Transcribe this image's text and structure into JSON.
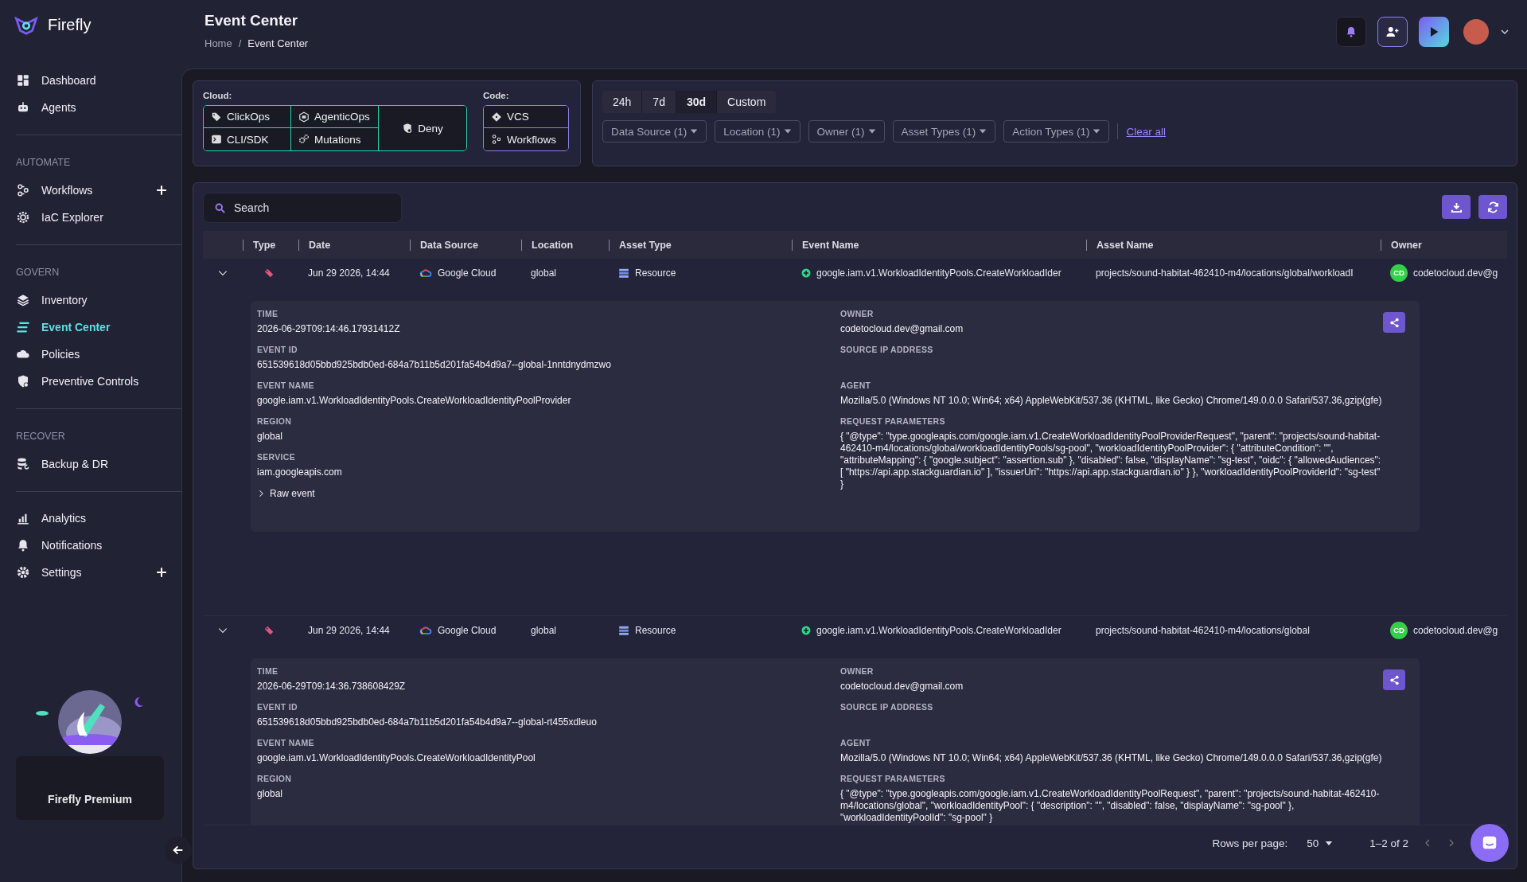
{
  "brand": {
    "name": "Firefly"
  },
  "sidebar": {
    "sections": [
      {
        "items": [
          {
            "label": "Dashboard",
            "selected": false,
            "addable": false
          },
          {
            "label": "Agents",
            "selected": false,
            "addable": false
          }
        ]
      },
      {
        "heading": "AUTOMATE",
        "items": [
          {
            "label": "Workflows",
            "selected": false,
            "addable": true
          },
          {
            "label": "IaC Explorer",
            "selected": false,
            "addable": false
          }
        ]
      },
      {
        "heading": "GOVERN",
        "items": [
          {
            "label": "Inventory",
            "selected": false,
            "addable": false
          },
          {
            "label": "Event Center",
            "selected": true,
            "addable": false
          },
          {
            "label": "Policies",
            "selected": false,
            "addable": false
          },
          {
            "label": "Preventive Controls",
            "selected": false,
            "addable": false
          }
        ]
      },
      {
        "heading": "RECOVER",
        "items": [
          {
            "label": "Backup & DR",
            "selected": false,
            "addable": false
          }
        ]
      },
      {
        "items": [
          {
            "label": "Analytics",
            "selected": false,
            "addable": false
          },
          {
            "label": "Notifications",
            "selected": false,
            "addable": false
          },
          {
            "label": "Settings",
            "selected": false,
            "addable": true
          }
        ]
      }
    ]
  },
  "premium": {
    "title": "Firefly Premium"
  },
  "header": {
    "title": "Event Center",
    "breadcrumbs": [
      "Home",
      "Event Center"
    ],
    "separator": "/"
  },
  "filters": {
    "cloud": {
      "label": "Cloud:",
      "options": [
        {
          "label": "ClickOps",
          "kind": "cell"
        },
        {
          "label": "AgenticOps",
          "kind": "cell"
        },
        {
          "label": "Deny",
          "kind": "wide"
        },
        {
          "label": "CLI/SDK",
          "kind": "cell"
        },
        {
          "label": "Mutations",
          "kind": "cell"
        }
      ]
    },
    "code": {
      "label": "Code:",
      "options": [
        "VCS",
        "Workflows"
      ]
    }
  },
  "time_range": {
    "tabs": [
      {
        "label": "24h",
        "selected": false
      },
      {
        "label": "7d",
        "selected": false
      },
      {
        "label": "30d",
        "selected": true
      },
      {
        "label": "Custom",
        "selected": false
      }
    ],
    "dropdowns": [
      "Data Source (1)",
      "Location (1)",
      "Owner (1)",
      "Asset Types (1)",
      "Action Types (1)"
    ],
    "clear_all": "Clear all"
  },
  "table": {
    "search_placeholder": "Search",
    "columns": [
      "Type",
      "Date",
      "Data Source",
      "Location",
      "Asset Type",
      "Event Name",
      "Asset Name",
      "Owner"
    ],
    "rows": [
      {
        "expanded": true,
        "date": "Jun 29 2026, 14:44",
        "data_source": "Google Cloud",
        "location": "global",
        "asset_type": "Resource",
        "event_name": "google.iam.v1.WorkloadIdentityPools.CreateWorkloadIder",
        "asset_name": "projects/sound-habitat-462410-m4/locations/global/workloadI",
        "owner_initials": "CD",
        "owner": "codetocloud.dev@g",
        "details": {
          "left": [
            {
              "label": "TIME",
              "value": "2026-06-29T09:14:46.17931412Z"
            },
            {
              "label": "EVENT ID",
              "value": "651539618d05bbd925bdb0ed-684a7b11b5d201fa54b4d9a7--global-1nntdnydmzwo"
            },
            {
              "label": "EVENT NAME",
              "value": "google.iam.v1.WorkloadIdentityPools.CreateWorkloadIdentityPoolProvider"
            },
            {
              "label": "REGION",
              "value": "global"
            },
            {
              "label": "SERVICE",
              "value": "iam.googleapis.com"
            }
          ],
          "raw_event": "Raw event",
          "right": [
            {
              "label": "OWNER",
              "value": "codetocloud.dev@gmail.com"
            },
            {
              "label": "SOURCE IP ADDRESS"
            },
            {
              "label": "AGENT",
              "value": "Mozilla/5.0 (Windows NT 10.0; Win64; x64) AppleWebKit/537.36 (KHTML, like Gecko) Chrome/149.0.0.0 Safari/537.36,gzip(gfe)"
            },
            {
              "label": "REQUEST PARAMETERS",
              "value": "{ \"@type\": \"type.googleapis.com/google.iam.v1.CreateWorkloadIdentityPoolProviderRequest\", \"parent\": \"projects/sound-habitat-462410-m4/locations/global/workloadIdentityPools/sg-pool\", \"workloadIdentityPoolProvider\": { \"attributeCondition\": \"\", \"attributeMapping\": { \"google.subject\": \"assertion.sub\" }, \"disabled\": false, \"displayName\": \"sg-test\", \"oidc\": { \"allowedAudiences\": [ \"https://api.app.stackguardian.io\" ], \"issuerUri\": \"https://api.app.stackguardian.io\" } }, \"workloadIdentityPoolProviderId\": \"sg-test\" }"
            }
          ]
        }
      },
      {
        "expanded": true,
        "date": "Jun 29 2026, 14:44",
        "data_source": "Google Cloud",
        "location": "global",
        "asset_type": "Resource",
        "event_name": "google.iam.v1.WorkloadIdentityPools.CreateWorkloadIder",
        "asset_name": "projects/sound-habitat-462410-m4/locations/global",
        "owner_initials": "CD",
        "owner": "codetocloud.dev@g",
        "details": {
          "left": [
            {
              "label": "TIME",
              "value": "2026-06-29T09:14:36.738608429Z"
            },
            {
              "label": "EVENT ID",
              "value": "651539618d05bbd925bdb0ed-684a7b11b5d201fa54b4d9a7--global-rt455xdleuo"
            },
            {
              "label": "EVENT NAME",
              "value": "google.iam.v1.WorkloadIdentityPools.CreateWorkloadIdentityPool"
            },
            {
              "label": "REGION",
              "value": "global"
            }
          ],
          "right": [
            {
              "label": "OWNER",
              "value": "codetocloud.dev@gmail.com"
            },
            {
              "label": "SOURCE IP ADDRESS"
            },
            {
              "label": "AGENT",
              "value": "Mozilla/5.0 (Windows NT 10.0; Win64; x64) AppleWebKit/537.36 (KHTML, like Gecko) Chrome/149.0.0.0 Safari/537.36,gzip(gfe)"
            },
            {
              "label": "REQUEST PARAMETERS",
              "value": "{ \"@type\": \"type.googleapis.com/google.iam.v1.CreateWorkloadIdentityPoolRequest\", \"parent\": \"projects/sound-habitat-462410-m4/locations/global\", \"workloadIdentityPool\": { \"description\": \"\", \"disabled\": false, \"displayName\": \"sg-pool\" }, \"workloadIdentityPoolId\": \"sg-pool\" }"
            }
          ]
        }
      }
    ]
  },
  "footer": {
    "rows_per_page_label": "Rows per page:",
    "rows_per_page": "50",
    "range": "1–2 of 2"
  }
}
